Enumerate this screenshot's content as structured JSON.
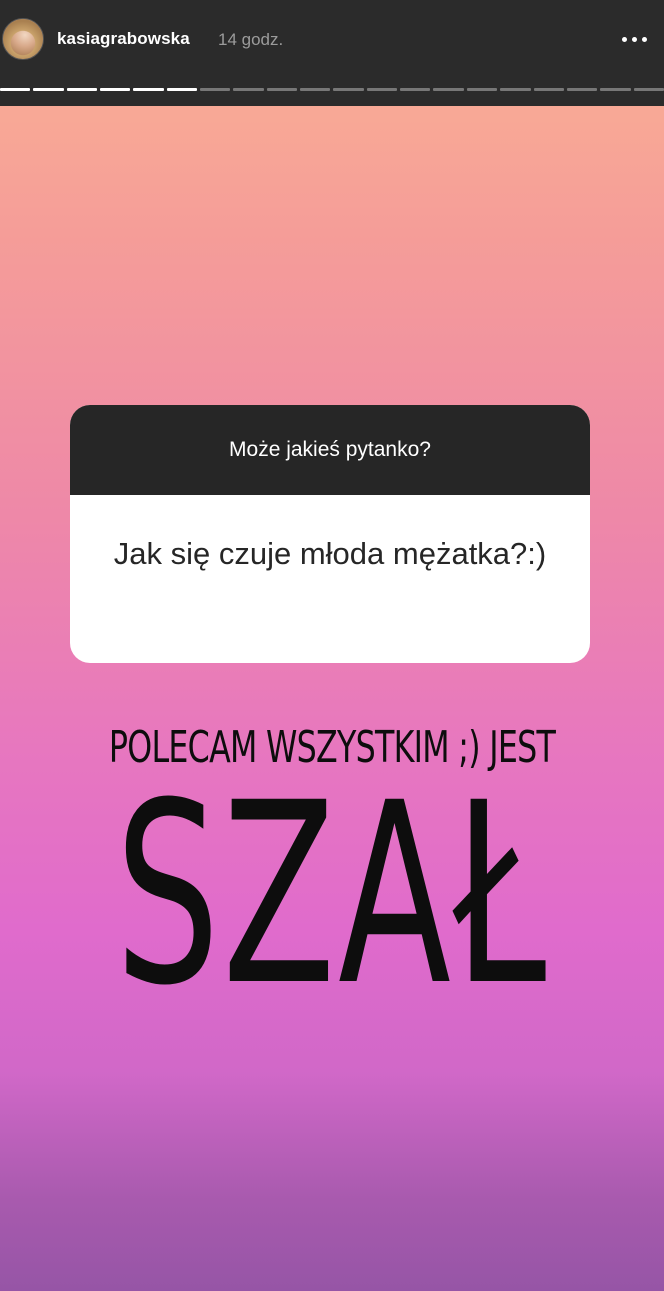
{
  "header": {
    "username": "kasiagrabowska",
    "timestamp": "14 godz.",
    "more_icon": "more-horizontal-icon",
    "avatar_icon": "profile-avatar"
  },
  "progress": {
    "total_segments": 20,
    "completed_segments": 6,
    "colors": {
      "done": "#ffffff",
      "pending": "#777777"
    }
  },
  "question_sticker": {
    "prompt": "Może jakieś pytanko?",
    "answer": "Jak się czuje młoda mężatka?:)"
  },
  "caption": {
    "line1": "POLECAM WSZYSTKIM ;) JEST",
    "big_word": "SZAŁ"
  },
  "colors": {
    "top_bar": "#2b2b2b",
    "gradient_top": "#fbb394",
    "gradient_bottom": "#9655a6",
    "sticker_header": "#262626",
    "text_dark": "#0d0d0d"
  }
}
